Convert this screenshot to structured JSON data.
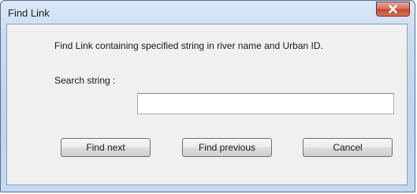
{
  "window": {
    "title": "Find Link",
    "close_icon": "close-x-icon"
  },
  "dialog": {
    "description": "Find Link containing specified string in river name and Urban ID.",
    "search_label": "Search string :",
    "search_value": "",
    "search_placeholder": ""
  },
  "buttons": {
    "find_next": "Find next",
    "find_previous": "Find previous",
    "cancel": "Cancel"
  },
  "colors": {
    "close_button": "#c9503a",
    "title_bar": "#c4d9f1",
    "client_bg": "#f0f0f0"
  }
}
